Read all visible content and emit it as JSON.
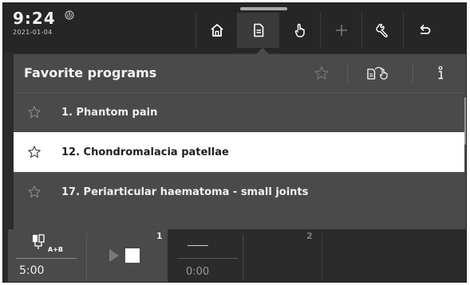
{
  "status": {
    "time": "9:24",
    "date": "2021-01-04"
  },
  "navbar": {
    "active": "programs",
    "items": [
      {
        "name": "home",
        "icon": "home-icon"
      },
      {
        "name": "programs",
        "icon": "document-icon"
      },
      {
        "name": "manual",
        "icon": "hand-pointer-icon"
      },
      {
        "name": "add",
        "icon": "plus-icon"
      },
      {
        "name": "tools",
        "icon": "wrench-icon"
      },
      {
        "name": "back",
        "icon": "return-arrow-icon"
      }
    ]
  },
  "panel": {
    "title": "Favorite programs",
    "actions": [
      "star-icon",
      "document-hand-icon",
      "info-icon"
    ]
  },
  "programs": [
    {
      "label": "1. Phantom pain",
      "selected": false
    },
    {
      "label": "12. Chondromalacia patellae",
      "selected": true
    },
    {
      "label": "17. Periarticular haematoma - small joints",
      "selected": false
    }
  ],
  "channels": [
    {
      "number": "1",
      "electrode_label": "A+B",
      "time": "5:00"
    },
    {
      "number": "",
      "time": "0:00"
    },
    {
      "number": "2"
    }
  ],
  "colors": {
    "background": "#2b2b2b",
    "panel": "#4a4a4a",
    "selected_row": "#ffffff",
    "text": "#f0f0f0"
  }
}
